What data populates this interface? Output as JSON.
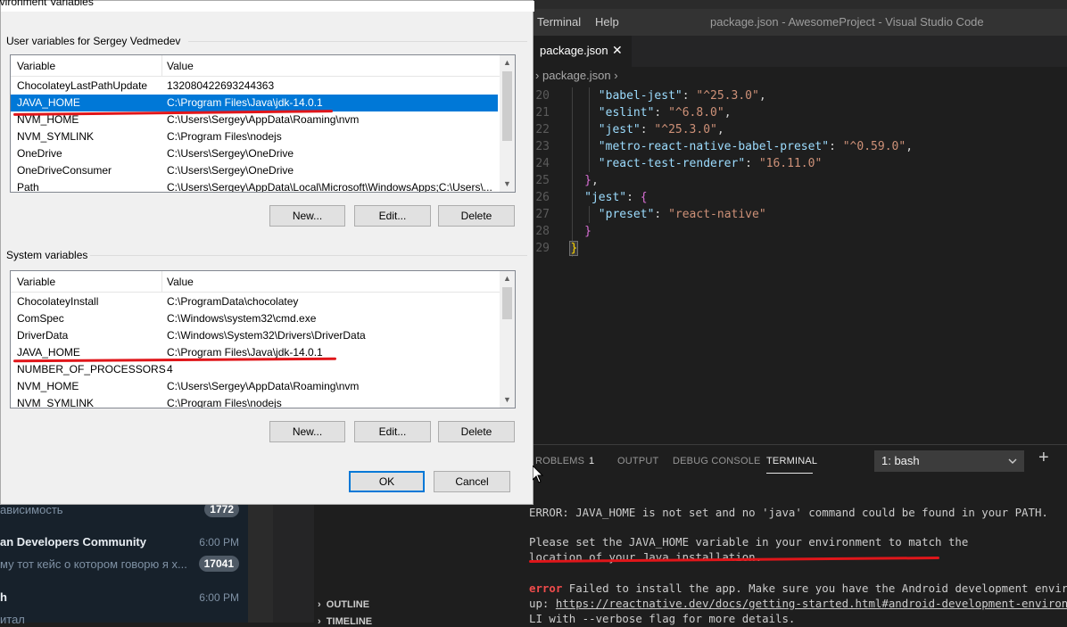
{
  "dialog": {
    "title": "nvironment Variables",
    "user_group_label": "User variables for Sergey Vedmedev",
    "system_group_label": "System variables",
    "col_variable": "Variable",
    "col_value": "Value",
    "user_vars": [
      {
        "name": "ChocolateyLastPathUpdate",
        "value": "132080422693244363"
      },
      {
        "name": "JAVA_HOME",
        "value": "C:\\Program Files\\Java\\jdk-14.0.1"
      },
      {
        "name": "NVM_HOME",
        "value": "C:\\Users\\Sergey\\AppData\\Roaming\\nvm"
      },
      {
        "name": "NVM_SYMLINK",
        "value": "C:\\Program Files\\nodejs"
      },
      {
        "name": "OneDrive",
        "value": "C:\\Users\\Sergey\\OneDrive"
      },
      {
        "name": "OneDriveConsumer",
        "value": "C:\\Users\\Sergey\\OneDrive"
      },
      {
        "name": "Path",
        "value": "C:\\Users\\Sergey\\AppData\\Local\\Microsoft\\WindowsApps;C:\\Users\\..."
      }
    ],
    "system_vars": [
      {
        "name": "ChocolateyInstall",
        "value": "C:\\ProgramData\\chocolatey"
      },
      {
        "name": "ComSpec",
        "value": "C:\\Windows\\system32\\cmd.exe"
      },
      {
        "name": "DriverData",
        "value": "C:\\Windows\\System32\\Drivers\\DriverData"
      },
      {
        "name": "JAVA_HOME",
        "value": "C:\\Program Files\\Java\\jdk-14.0.1"
      },
      {
        "name": "NUMBER_OF_PROCESSORS",
        "value": "4"
      },
      {
        "name": "NVM_HOME",
        "value": "C:\\Users\\Sergey\\AppData\\Roaming\\nvm"
      },
      {
        "name": "NVM_SYMLINK",
        "value": "C:\\Program Files\\nodejs"
      }
    ],
    "btn_new": "New...",
    "btn_edit": "Edit...",
    "btn_delete": "Delete",
    "btn_ok": "OK",
    "btn_cancel": "Cancel"
  },
  "chat": {
    "row1_msg": "ависимость",
    "row1_badge": "1772",
    "row2_name": "an Developers Community",
    "row2_time": "6:00 PM",
    "row2_msg": "му тот кейс о котором говорю я х...",
    "row2_badge": "17041",
    "row3_name": "h",
    "row3_time": "6:00 PM",
    "row3_msg": "итал"
  },
  "vscode": {
    "menu_terminal": "Terminal",
    "menu_help": "Help",
    "window_title": "package.json - AwesomeProject - Visual Studio Code",
    "tab_label": "package.json",
    "tab_close": "✕",
    "breadcrumb": "package.json",
    "code": {
      "l20_n": "20",
      "l20_k": "\"babel-jest\"",
      "l20_v": "\"^25.3.0\"",
      "l21_n": "21",
      "l21_k": "\"eslint\"",
      "l21_v": "\"^6.8.0\"",
      "l22_n": "22",
      "l22_k": "\"jest\"",
      "l22_v": "\"^25.3.0\"",
      "l23_n": "23",
      "l23_k": "\"metro-react-native-babel-preset\"",
      "l23_v": "\"^0.59.0\"",
      "l24_n": "24",
      "l24_k": "\"react-test-renderer\"",
      "l24_v": "\"16.11.0\"",
      "l25_n": "25",
      "l26_n": "26",
      "l26_k": "\"jest\"",
      "l27_n": "27",
      "l27_k": "\"preset\"",
      "l27_v": "\"react-native\"",
      "l28_n": "28",
      "l29_n": "29"
    },
    "panel": {
      "problems": "ROBLEMS",
      "problems_count": "1",
      "output": "OUTPUT",
      "debug_console": "DEBUG CONSOLE",
      "terminal": "TERMINAL",
      "terminal_select": "1: bash",
      "add": "+"
    },
    "terminal_lines": {
      "l1": "ERROR: JAVA_HOME is not set and no 'java' command could be found in your PATH.",
      "l2": "Please set the JAVA_HOME variable in your environment to match the",
      "l3": "location of your Java installation.",
      "l4_err": "error",
      "l4_rest": " Failed to install the app. Make sure you have the Android development environment",
      "l5_pre": "up: ",
      "l5_link": "https://reactnative.dev/docs/getting-started.html#android-development-environment",
      "l5_post": ".",
      "l6": "LI with --verbose flag for more details."
    },
    "outline": "OUTLINE",
    "timeline": "TIMELINE"
  }
}
